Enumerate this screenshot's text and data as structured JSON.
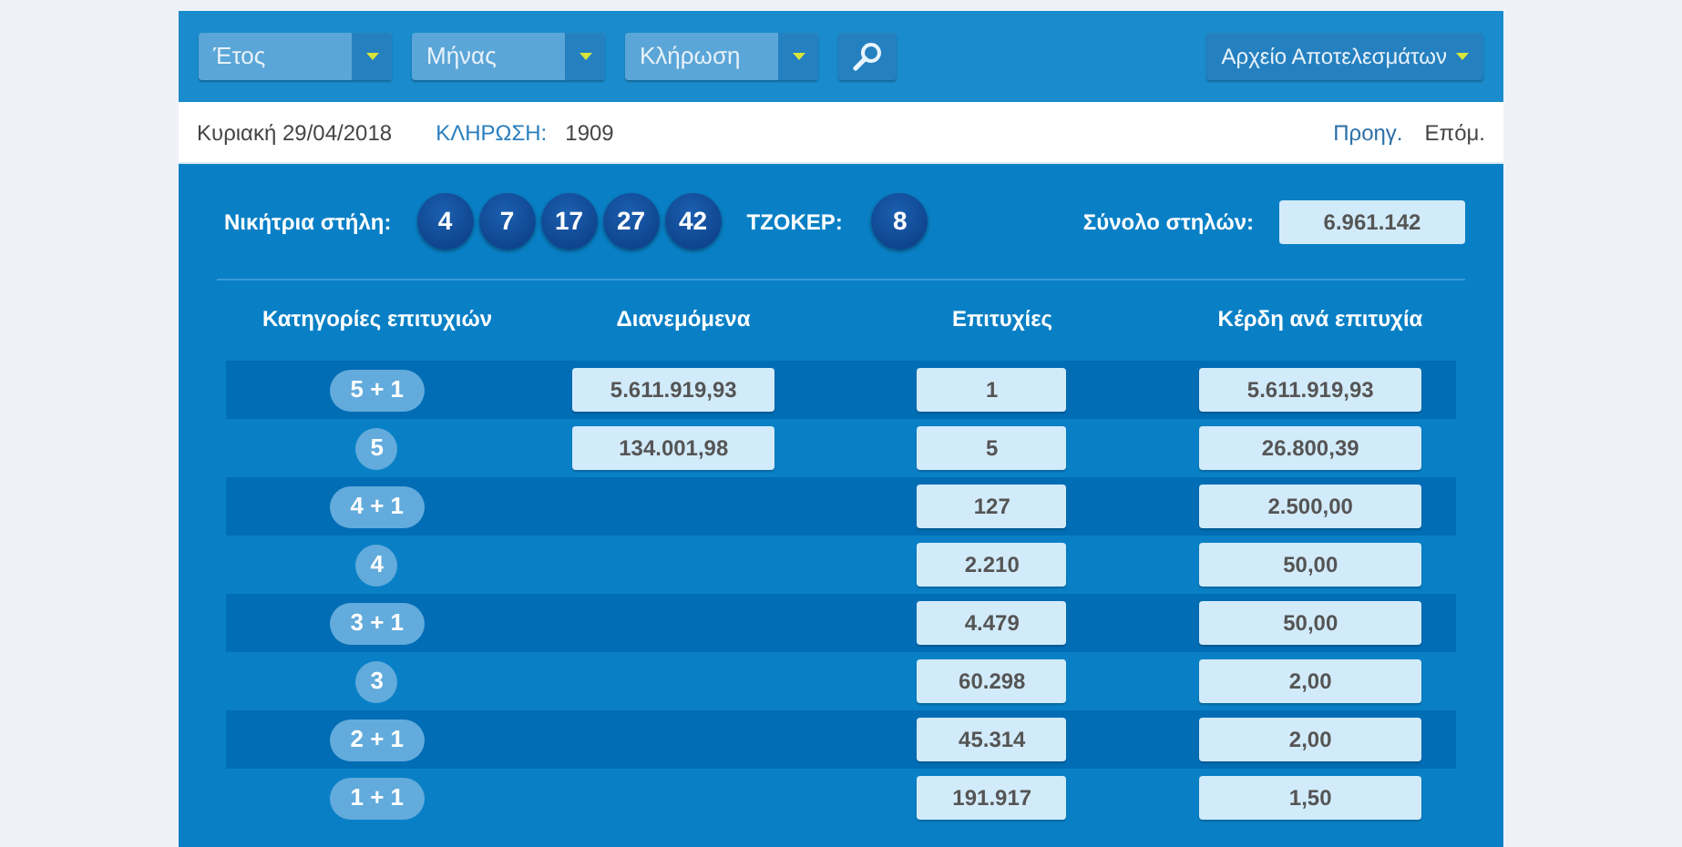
{
  "toolbar": {
    "dropdowns": [
      {
        "label": "Έτος"
      },
      {
        "label": "Μήνας"
      },
      {
        "label": "Κλήρωση"
      }
    ],
    "archive_button": "Αρχείο Αποτελεσμάτων"
  },
  "info_bar": {
    "date": "Κυριακή 29/04/2018",
    "draw_label": "ΚΛΗΡΩΣΗ:",
    "draw_number": "1909",
    "prev": "Προηγ.",
    "next": "Επόμ."
  },
  "winning": {
    "label": "Νικήτρια στήλη:",
    "numbers": [
      "4",
      "7",
      "17",
      "27",
      "42"
    ],
    "joker_label": "ΤΖΟΚΕΡ:",
    "joker": "8",
    "total_label": "Σύνολο στηλών:",
    "total": "6.961.142"
  },
  "table": {
    "columns": [
      "Κατηγορίες επιτυχιών",
      "Διανεμόμενα",
      "Επιτυχίες",
      "Κέρδη ανά επιτυχία"
    ],
    "rows": [
      {
        "category": "5 + 1",
        "distributed": "5.611.919,93",
        "winners": "1",
        "prize": "5.611.919,93"
      },
      {
        "category": "5",
        "distributed": "134.001,98",
        "winners": "5",
        "prize": "26.800,39"
      },
      {
        "category": "4 + 1",
        "winners": "127",
        "prize": "2.500,00"
      },
      {
        "category": "4",
        "winners": "2.210",
        "prize": "50,00"
      },
      {
        "category": "3 + 1",
        "winners": "4.479",
        "prize": "50,00"
      },
      {
        "category": "3",
        "winners": "60.298",
        "prize": "2,00"
      },
      {
        "category": "2 + 1",
        "winners": "45.314",
        "prize": "2,00"
      },
      {
        "category": "1 + 1",
        "winners": "191.917",
        "prize": "1,50"
      }
    ]
  }
}
